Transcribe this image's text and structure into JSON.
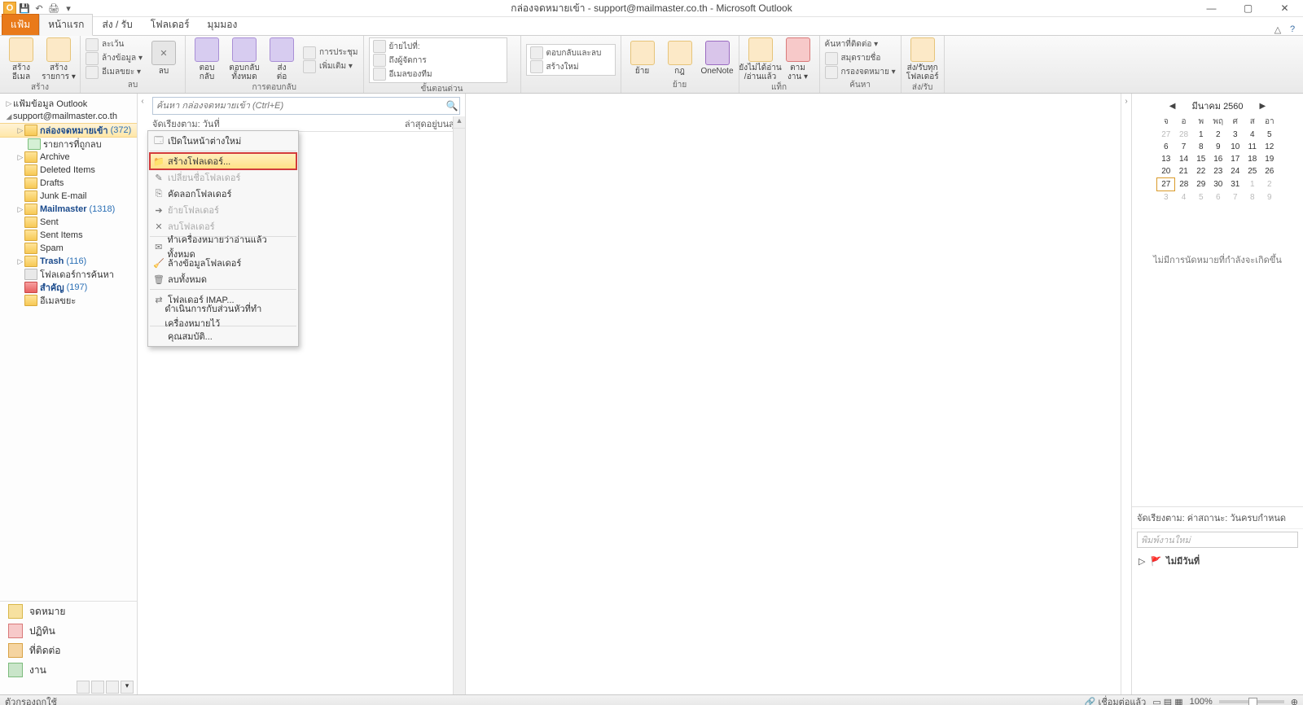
{
  "titlebar": {
    "title": "กล่องจดหมายเข้า - support@mailmaster.co.th - Microsoft Outlook"
  },
  "tabs": {
    "file": "แฟ้ม",
    "home": "หน้าแรก",
    "sendreceive": "ส่ง / รับ",
    "folder": "โฟลเดอร์",
    "view": "มุมมอง"
  },
  "ribbon": {
    "new_email": "สร้าง\nอีเมล",
    "new_items": "สร้าง\nรายการ ▾",
    "group_new": "สร้าง",
    "ignore": "ละเว้น",
    "cleanup": "ล้างข้อมูล ▾",
    "junk": "อีเมลขยะ ▾",
    "delete": "ลบ",
    "group_delete": "ลบ",
    "reply": "ตอบ\nกลับ",
    "replyall": "ตอบกลับ\nทั้งหมด",
    "forward": "ส่ง\nต่อ",
    "meeting": "การประชุม",
    "more_respond": "เพิ่มเติม ▾",
    "group_respond": "การตอบกลับ",
    "moveto": "ย้ายไปที่:",
    "tomanager": "ถึงผู้จัดการ",
    "teamemail": "อีเมลของทีม",
    "replyanddelete": "ตอบกลับและลบ",
    "createnew": "สร้างใหม่",
    "group_quicksteps": "ขั้นตอนด่วน",
    "move": "ย้าย",
    "rules": "กฎ",
    "onenote": "OneNote",
    "group_move": "ย้าย",
    "unread": "ยังไม่ได้อ่าน\n/อ่านแล้ว",
    "followup": "ตาม\nงาน ▾",
    "group_tags": "แท็ก",
    "findcontact": "ค้นหาที่ติดต่อ ▾",
    "addressbook": "สมุดรายชื่อ",
    "filteremail": "กรองจดหมาย ▾",
    "group_find": "ค้นหา",
    "sendreceiveall": "ส่ง/รับทุก\nโฟลเดอร์",
    "group_sendreceive": "ส่ง/รับ"
  },
  "nav": {
    "root1": "แฟ้มข้อมูล Outlook",
    "account": "support@mailmaster.co.th",
    "inbox": "กล่องจดหมายเข้า",
    "inbox_count": "(372)",
    "deleteditems_sub": "รายการที่ถูกลบ",
    "archive": "Archive",
    "deleted": "Deleted Items",
    "drafts": "Drafts",
    "junk": "Junk E-mail",
    "mailmaster": "Mailmaster",
    "mailmaster_count": "(1318)",
    "sent": "Sent",
    "sentitems": "Sent Items",
    "spam": "Spam",
    "trash": "Trash",
    "trash_count": "(116)",
    "searchfolders": "โฟลเดอร์การค้นหา",
    "important": "สำคัญ",
    "important_count": "(197)",
    "junk2": "อีเมลขยะ",
    "sec_mail": "จดหมาย",
    "sec_calendar": "ปฏิทิน",
    "sec_contacts": "ที่ติดต่อ",
    "sec_tasks": "งาน"
  },
  "mid": {
    "search_placeholder": "ค้นหา กล่องจดหมายเข้า (Ctrl+E)",
    "sort_label": "จัดเรียงตาม: วันที่",
    "sort_right": "ล่าสุดอยู่บนสุด"
  },
  "ctx": {
    "open_new": "เปิดในหน้าต่างใหม่",
    "new_folder": "สร้างโฟลเดอร์...",
    "rename": "เปลี่ยนชื่อโฟลเดอร์",
    "copy": "คัดลอกโฟลเดอร์",
    "move": "ย้ายโฟลเดอร์",
    "delete": "ลบโฟลเดอร์",
    "markallread": "ทำเครื่องหมายว่าอ่านแล้วทั้งหมด",
    "cleanfolder": "ล้างข้อมูลโฟลเดอร์",
    "deleteall": "ลบทั้งหมด",
    "imapfolders": "โฟลเดอร์ IMAP...",
    "processmark": "ดำเนินการกับส่วนหัวที่ทำเครื่องหมายไว้",
    "properties": "คุณสมบัติ..."
  },
  "cal": {
    "title": "มีนาคม 2560",
    "dow": [
      "จ",
      "อ",
      "พ",
      "พฤ",
      "ศ",
      "ส",
      "อา"
    ],
    "weeks": [
      [
        {
          "n": "27",
          "off": true
        },
        {
          "n": "28",
          "off": true
        },
        {
          "n": "1"
        },
        {
          "n": "2"
        },
        {
          "n": "3"
        },
        {
          "n": "4"
        },
        {
          "n": "5"
        }
      ],
      [
        {
          "n": "6"
        },
        {
          "n": "7"
        },
        {
          "n": "8"
        },
        {
          "n": "9"
        },
        {
          "n": "10"
        },
        {
          "n": "11"
        },
        {
          "n": "12"
        }
      ],
      [
        {
          "n": "13"
        },
        {
          "n": "14"
        },
        {
          "n": "15"
        },
        {
          "n": "16"
        },
        {
          "n": "17"
        },
        {
          "n": "18"
        },
        {
          "n": "19"
        }
      ],
      [
        {
          "n": "20"
        },
        {
          "n": "21"
        },
        {
          "n": "22"
        },
        {
          "n": "23"
        },
        {
          "n": "24"
        },
        {
          "n": "25"
        },
        {
          "n": "26"
        }
      ],
      [
        {
          "n": "27",
          "today": true
        },
        {
          "n": "28"
        },
        {
          "n": "29"
        },
        {
          "n": "30"
        },
        {
          "n": "31"
        },
        {
          "n": "1",
          "off": true
        },
        {
          "n": "2",
          "off": true
        }
      ],
      [
        {
          "n": "3",
          "off": true
        },
        {
          "n": "4",
          "off": true
        },
        {
          "n": "5",
          "off": true
        },
        {
          "n": "6",
          "off": true
        },
        {
          "n": "7",
          "off": true
        },
        {
          "n": "8",
          "off": true
        },
        {
          "n": "9",
          "off": true
        }
      ]
    ],
    "noappt": "ไม่มีการนัดหมายที่กำลังจะเกิดขึ้น"
  },
  "tasks": {
    "header": "จัดเรียงตาม: ค่าสถานะ: วันครบกำหนด",
    "input": "พิมพ์งานใหม่",
    "group": "ไม่มีวันที่"
  },
  "status": {
    "filter": "ตัวกรองถูกใช้",
    "connected": "เชื่อมต่อแล้ว",
    "zoom": "100%"
  }
}
